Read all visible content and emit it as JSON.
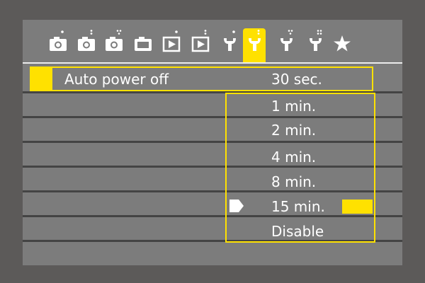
{
  "tabs": [
    {
      "icon": "camera-shooting-menu-1-icon"
    },
    {
      "icon": "camera-shooting-menu-2-icon"
    },
    {
      "icon": "camera-shooting-menu-3-icon"
    },
    {
      "icon": "camera-shooting-menu-4-icon"
    },
    {
      "icon": "playback-menu-1-icon"
    },
    {
      "icon": "playback-menu-2-icon"
    },
    {
      "icon": "setup-menu-1-icon"
    },
    {
      "icon": "setup-menu-2-icon",
      "active": true
    },
    {
      "icon": "setup-menu-3-icon"
    },
    {
      "icon": "setup-menu-4-icon"
    },
    {
      "icon": "my-menu-star-icon"
    }
  ],
  "setting": {
    "label": "Auto power off",
    "value": "30 sec."
  },
  "options": [
    "1 min.",
    "2 min.",
    "4 min.",
    "8 min.",
    "15 min.",
    "Disable"
  ],
  "highlighted_option": "15 min.",
  "colors": {
    "accent": "#ffe100",
    "panel": "#7c7c7c",
    "outer": "#5c5a59",
    "divider": "#444444",
    "text": "#ffffff"
  }
}
